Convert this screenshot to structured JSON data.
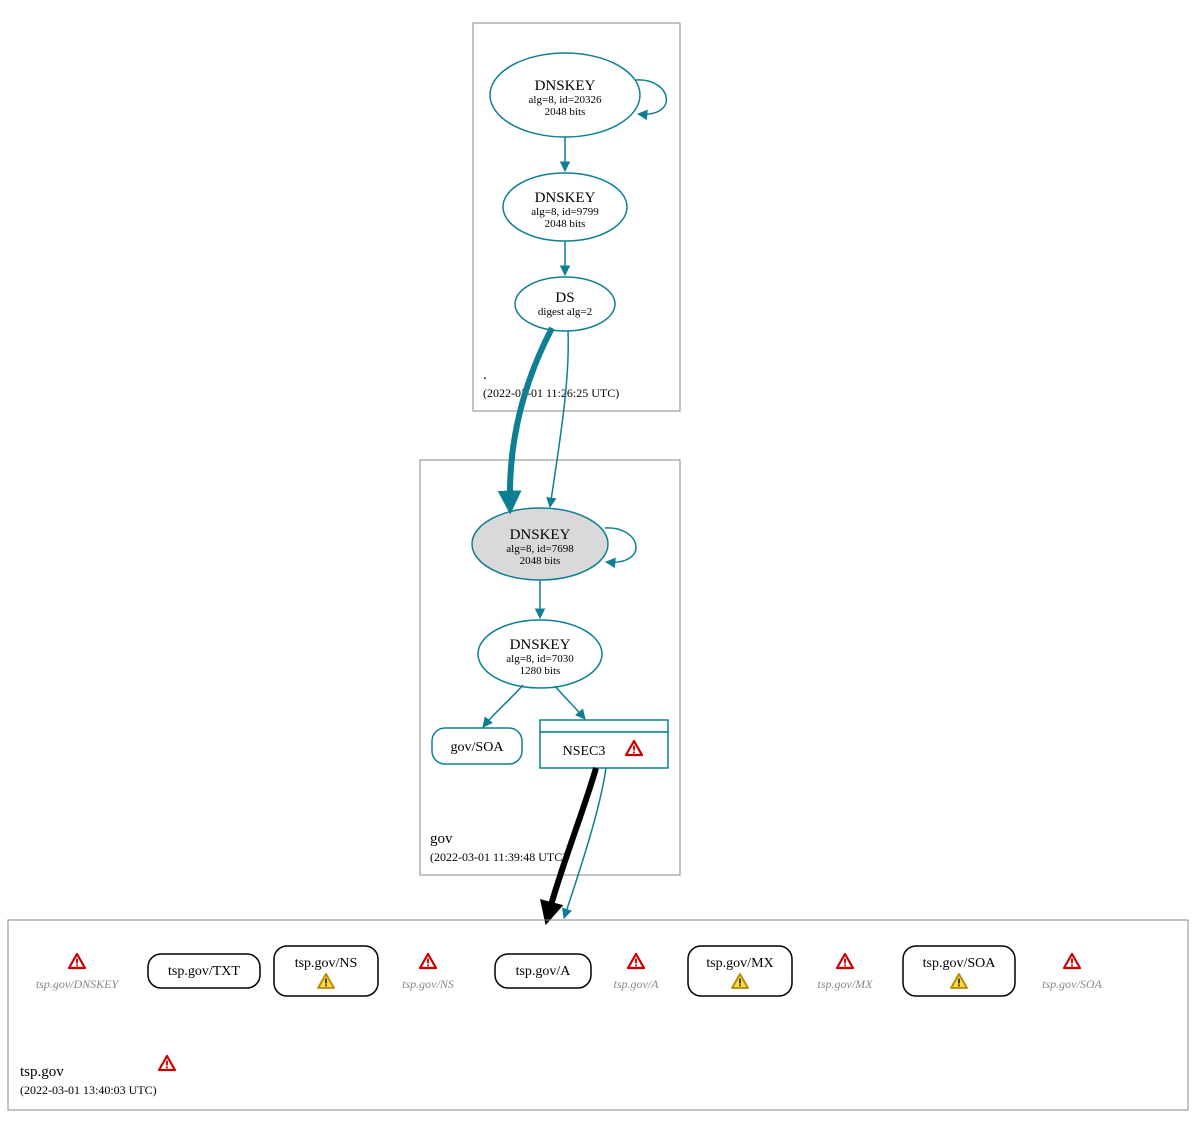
{
  "zones": {
    "root": {
      "name": ".",
      "timestamp": "(2022-03-01 11:26:25 UTC)",
      "nodes": {
        "ksk": {
          "title": "DNSKEY",
          "line2": "alg=8, id=20326",
          "line3": "2048 bits"
        },
        "zsk": {
          "title": "DNSKEY",
          "line2": "alg=8, id=9799",
          "line3": "2048 bits"
        },
        "ds": {
          "title": "DS",
          "line2": "digest alg=2"
        }
      }
    },
    "gov": {
      "name": "gov",
      "timestamp": "(2022-03-01 11:39:48 UTC)",
      "nodes": {
        "ksk": {
          "title": "DNSKEY",
          "line2": "alg=8, id=7698",
          "line3": "2048 bits"
        },
        "zsk": {
          "title": "DNSKEY",
          "line2": "alg=8, id=7030",
          "line3": "1280 bits"
        },
        "soa": {
          "label": "gov/SOA"
        },
        "nsec3": {
          "label": "NSEC3"
        }
      }
    },
    "tsp": {
      "name": "tsp.gov",
      "timestamp": "(2022-03-01 13:40:03 UTC)",
      "items": [
        {
          "kind": "ghost",
          "label": "tsp.gov/DNSKEY"
        },
        {
          "kind": "rr",
          "label": "tsp.gov/TXT",
          "warn": false
        },
        {
          "kind": "rr",
          "label": "tsp.gov/NS",
          "warn": true
        },
        {
          "kind": "ghost",
          "label": "tsp.gov/NS"
        },
        {
          "kind": "rr",
          "label": "tsp.gov/A",
          "warn": false
        },
        {
          "kind": "ghost",
          "label": "tsp.gov/A"
        },
        {
          "kind": "rr",
          "label": "tsp.gov/MX",
          "warn": true
        },
        {
          "kind": "ghost",
          "label": "tsp.gov/MX"
        },
        {
          "kind": "rr",
          "label": "tsp.gov/SOA",
          "warn": true
        },
        {
          "kind": "ghost",
          "label": "tsp.gov/SOA"
        }
      ]
    }
  }
}
